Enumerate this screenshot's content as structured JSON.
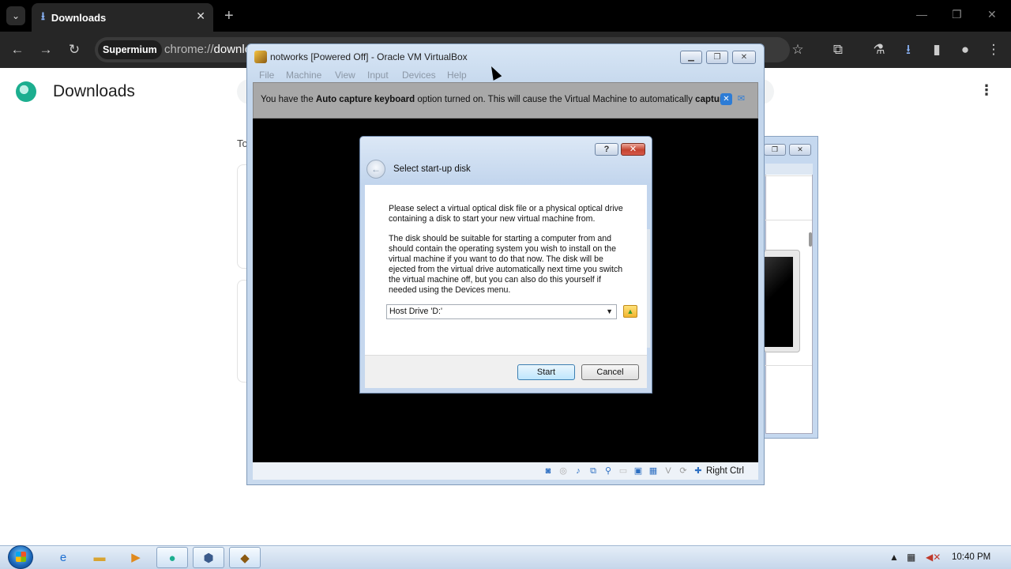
{
  "browser": {
    "tab_title": "Downloads",
    "site_chip": "Supermium",
    "url_prefix": "chrome://",
    "url_host": "downlo",
    "page_title": "Downloads",
    "today_label": "To"
  },
  "vm_window": {
    "title": "notworks [Powered Off] - Oracle VM VirtualBox",
    "menu": [
      "File",
      "Machine",
      "View",
      "Input",
      "Devices",
      "Help"
    ],
    "banner": {
      "part1": "You have the ",
      "bold1": "Auto capture keyboard",
      "part2": " option turned on. This will cause the Virtual Machine to automatically ",
      "bold2": "capture"
    },
    "host_key": "Right Ctrl"
  },
  "dialog": {
    "help_label": "?",
    "title": "Select start-up disk",
    "para1": "Please select a virtual optical disk file or a physical optical drive\ncontaining a disk to start your new virtual machine from.",
    "para2": "The disk should be suitable for starting a computer from and\nshould contain the operating system you wish to install on the\nvirtual machine if you want to do that now. The disk will be\nejected from the virtual drive automatically next time you switch\nthe virtual machine off, but you can also do this yourself if\nneeded using the Devices menu.",
    "selected_drive": "Host Drive 'D:'",
    "start_label": "Start",
    "cancel_label": "Cancel"
  },
  "taskbar": {
    "clock": "10:40 PM",
    "apps": [
      "internet-explorer-icon",
      "folder-icon",
      "media-player-icon",
      "supermium-icon",
      "virtualbox-manager-icon",
      "virtualbox-vm-icon"
    ]
  },
  "colors": {
    "chrome_dark": "#262626",
    "vbox_frame": "#c3d6ec",
    "vm_screen": "#000000",
    "banner": "#a8a8a8"
  }
}
